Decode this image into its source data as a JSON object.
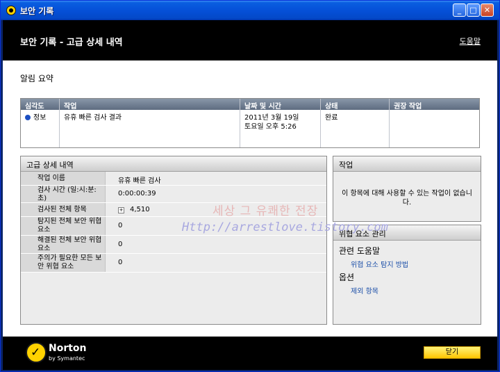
{
  "window": {
    "title": "보안 기록"
  },
  "header": {
    "title": "보안 기록 - 고급 상세 내역",
    "help": "도움말"
  },
  "summary": {
    "section_title": "알림 요약",
    "columns": [
      "심각도",
      "작업",
      "날짜 및 시간",
      "상태",
      "권장 작업"
    ],
    "row": {
      "severity": "정보",
      "task": "유휴 빠른 검사 결과",
      "date": "2011년 3월 19일",
      "time": "토요일 오후 5:26",
      "status": "완료",
      "recommended": ""
    }
  },
  "details": {
    "title": "고급 상세 내역",
    "rows": [
      {
        "label": "작업 이름",
        "value": "유휴 빠른 검사"
      },
      {
        "label": "검사 시간 (일:시:분:초)",
        "value": "0:00:00:39"
      },
      {
        "label": "검사된 전체 항목",
        "value": "4,510"
      },
      {
        "label": "탐지된 전체 보안 위협 요소",
        "value": "0"
      },
      {
        "label": "해결된 전체 보안 위협 요소",
        "value": "0"
      },
      {
        "label": "주의가 필요한 모든 보안 위협 요소",
        "value": "0"
      }
    ]
  },
  "actions": {
    "title": "작업",
    "text": "이 항목에 대해 사용할 수 있는 작업이 없습니다."
  },
  "threat_mgmt": {
    "title": "위협 요소 관리",
    "help_heading": "관련 도움말",
    "help_link": "위협 요소 탐지 방법",
    "options_heading": "옵션",
    "options_link": "제외 항목"
  },
  "footer": {
    "brand": "Norton",
    "brand_sub": "by Symantec",
    "close": "닫기"
  },
  "watermark": {
    "line1": "세상 그 유쾌한 전장",
    "line2": "Http://arrestlove.tistory.com"
  },
  "colors": {
    "titlebar": "#0550d8",
    "header_bg": "#000000",
    "close_button": "#ffd200",
    "severity_dot": "#1c4fc2"
  }
}
